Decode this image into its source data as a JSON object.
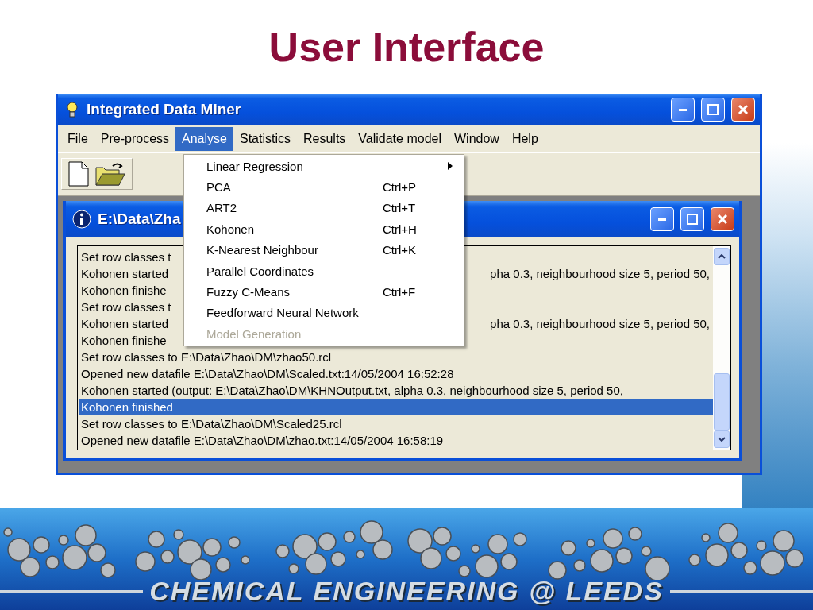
{
  "slide_title": "User Interface",
  "window": {
    "title": "Integrated Data Miner"
  },
  "menu_bar": [
    {
      "label": "File",
      "selected": false
    },
    {
      "label": "Pre-process",
      "selected": false
    },
    {
      "label": "Analyse",
      "selected": true
    },
    {
      "label": "Statistics",
      "selected": false
    },
    {
      "label": "Results",
      "selected": false
    },
    {
      "label": "Validate model",
      "selected": false
    },
    {
      "label": "Window",
      "selected": false
    },
    {
      "label": "Help",
      "selected": false
    }
  ],
  "dropdown": [
    {
      "label": "Linear Regression",
      "submenu": true,
      "disabled": false
    },
    {
      "label": "PCA",
      "shortcut": "Ctrl+P",
      "submenu": false,
      "disabled": false
    },
    {
      "label": "ART2",
      "shortcut": "Ctrl+T",
      "submenu": false,
      "disabled": false
    },
    {
      "label": "Kohonen",
      "shortcut": "Ctrl+H",
      "submenu": false,
      "disabled": false
    },
    {
      "label": "K-Nearest Neighbour",
      "shortcut": "Ctrl+K",
      "submenu": false,
      "disabled": false
    },
    {
      "label": "Parallel Coordinates",
      "submenu": false,
      "disabled": false
    },
    {
      "label": "Fuzzy C-Means",
      "shortcut": "Ctrl+F",
      "submenu": false,
      "disabled": false
    },
    {
      "label": "Feedforward Neural Network",
      "submenu": false,
      "disabled": false
    },
    {
      "label": "Model Generation",
      "submenu": false,
      "disabled": true
    }
  ],
  "child_window": {
    "title": "E:\\Data\\Zha"
  },
  "log": [
    {
      "text": "Set row classes t",
      "selected": false
    },
    {
      "text": "Kohonen started",
      "tail": "pha 0.3, neighbourhood size 5, period 50,",
      "selected": false
    },
    {
      "text": "Kohonen finishe",
      "selected": false
    },
    {
      "text": "Set row classes t",
      "selected": false
    },
    {
      "text": "Kohonen started",
      "tail": "pha 0.3, neighbourhood size 5, period 50,",
      "selected": false
    },
    {
      "text": "Kohonen finishe",
      "selected": false
    },
    {
      "text": "Set row classes to E:\\Data\\Zhao\\DM\\zhao50.rcl",
      "selected": false
    },
    {
      "text": "Opened new datafile E:\\Data\\Zhao\\DM\\Scaled.txt:14/05/2004 16:52:28",
      "selected": false
    },
    {
      "text": "Kohonen started (output: E:\\Data\\Zhao\\DM\\KHNOutput.txt, alpha 0.3, neighbourhood size 5, period 50,",
      "selected": false
    },
    {
      "text": "Kohonen finished",
      "selected": true
    },
    {
      "text": "Set row classes to E:\\Data\\Zhao\\DM\\Scaled25.rcl",
      "selected": false
    },
    {
      "text": "Opened new datafile E:\\Data\\Zhao\\DM\\zhao.txt:14/05/2004 16:58:19",
      "selected": false
    }
  ],
  "footer": "CHEMICAL ENGINEERING @ LEEDS"
}
